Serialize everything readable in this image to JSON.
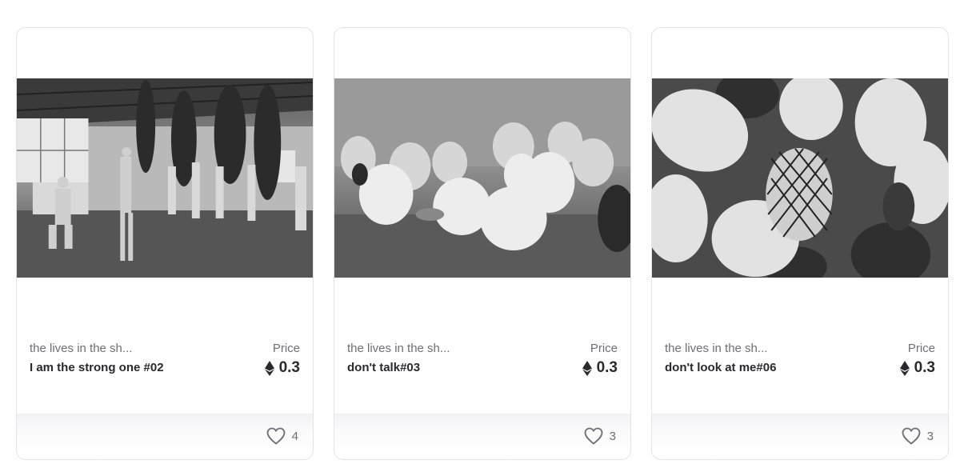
{
  "cards": [
    {
      "collection": "the lives in the sh...",
      "name": "I am the strong one #02",
      "price_label": "Price",
      "currency_icon": "ethereum-icon",
      "price": "0.3",
      "likes": "4",
      "like_icon": "heart-icon"
    },
    {
      "collection": "the lives in the sh...",
      "name": "don't talk#03",
      "price_label": "Price",
      "currency_icon": "ethereum-icon",
      "price": "0.3",
      "likes": "3",
      "like_icon": "heart-icon"
    },
    {
      "collection": "the lives in the sh...",
      "name": "don't look at me#06",
      "price_label": "Price",
      "currency_icon": "ethereum-icon",
      "price": "0.3",
      "likes": "3",
      "like_icon": "heart-icon"
    }
  ]
}
